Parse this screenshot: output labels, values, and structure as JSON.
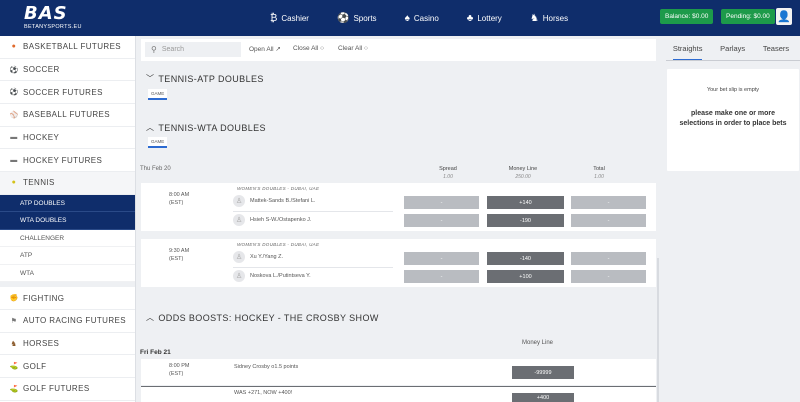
{
  "header": {
    "logo_mark": "BAS",
    "logo_sub": "BETANYSPORTS.EU",
    "nav": [
      {
        "label": "Cashier",
        "icon": "cash-icon"
      },
      {
        "label": "Sports",
        "icon": "ball-icon"
      },
      {
        "label": "Casino",
        "icon": "cards-icon"
      },
      {
        "label": "Lottery",
        "icon": "lottery-icon"
      },
      {
        "label": "Horses",
        "icon": "horse-icon"
      }
    ],
    "balance": "Balance: $0.00",
    "pending": "Pending: $0.00",
    "brand_color": "#0f2d6b",
    "green": "#1d9a4a"
  },
  "sidebar": {
    "items_top": [
      "BASKETBALL FUTURES",
      "SOCCER",
      "SOCCER FUTURES",
      "BASEBALL FUTURES",
      "HOCKEY",
      "HOCKEY FUTURES",
      "TENNIS"
    ],
    "tennis_subs": [
      "ATP DOUBLES",
      "WTA DOUBLES",
      "CHALLENGER",
      "ATP",
      "WTA"
    ],
    "items_bottom": [
      "FIGHTING",
      "AUTO RACING FUTURES",
      "HORSES",
      "GOLF",
      "GOLF FUTURES"
    ]
  },
  "toolbar": {
    "search_placeholder": "Search",
    "open_all": "Open All",
    "close_all": "Close All",
    "clear_all": "Clear All"
  },
  "main": {
    "section1": "TENNIS-ATP DOUBLES",
    "section2": "TENNIS-WTA DOUBLES",
    "game_tab": "GAME",
    "date1": "Thu Feb 20",
    "col_spread": "Spread",
    "col_spread_sub": "1.00",
    "col_money": "Money Line",
    "col_money_sub": "250.00",
    "col_total": "Total",
    "col_total_sub": "1.00",
    "events": [
      {
        "time": "8:00 AM",
        "tz": "(EST)",
        "league": "WOMEN'S DOUBLES - DUBAI, UAE",
        "p1": "Mattek-Sands B./Stefani L.",
        "p2": "Hsieh S-W./Ostapenko J.",
        "ml1": "+140",
        "ml2": "-190",
        "empty": "-"
      },
      {
        "time": "9:30 AM",
        "tz": "(EST)",
        "league": "WOMEN'S DOUBLES - DUBAI, UAE",
        "p1": "Xu Y./Yang Z.",
        "p2": "Noskova L./Putintseva Y.",
        "ml1": "-140",
        "ml2": "+100",
        "empty": "-"
      }
    ],
    "boost_title": "ODDS BOOSTS: HOCKEY - THE CROSBY SHOW",
    "boost_col": "Money Line",
    "date2": "Fri Feb 21",
    "boost_time": "8:00 PM",
    "boost_tz": "(EST)",
    "boost_prop": "Sidney Crosby o1.5 points",
    "boost_odds": "-99999",
    "boost_note": "WAS +271, NOW +400!",
    "boost_odds2": "+400"
  },
  "betslip": {
    "tabs": [
      "Straights",
      "Parlays",
      "Teasers"
    ],
    "empty": "Your bet slip is empty",
    "msg": "please make one or more selections in order to place bets"
  }
}
